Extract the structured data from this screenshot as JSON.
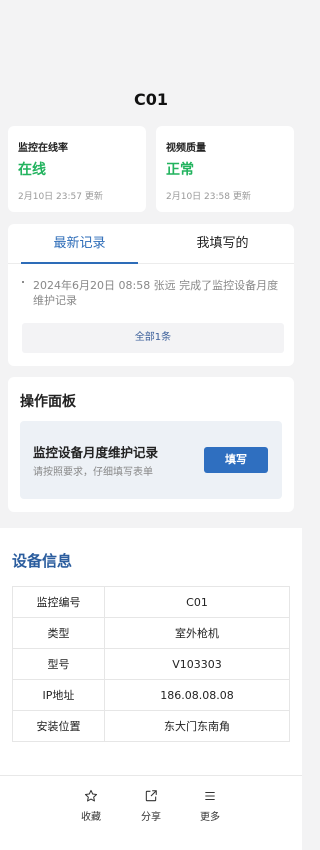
{
  "device": {
    "title": "C01"
  },
  "stats": [
    {
      "label": "监控在线率",
      "value": "在线",
      "time": "2月10日 23:57 更新"
    },
    {
      "label": "视频质量",
      "value": "正常",
      "time": "2月10日 23:58 更新"
    }
  ],
  "records": {
    "tabs": [
      "最新记录",
      "我填写的"
    ],
    "active_tab": "最新记录",
    "items": [
      {
        "text": "2024年6月20日 08:58  张远  完成了监控设备月度维护记录"
      }
    ],
    "all_label": "全部1条"
  },
  "ops": {
    "title": "操作面板",
    "task_name": "监控设备月度维护记录",
    "task_desc": "请按照要求，仔细填写表单",
    "fill_label": "填写"
  },
  "info": {
    "title": "设备信息",
    "rows": [
      {
        "key": "监控编号",
        "value": "C01"
      },
      {
        "key": "类型",
        "value": "室外枪机"
      },
      {
        "key": "型号",
        "value": "V103303"
      },
      {
        "key": "IP地址",
        "value": "186.08.08.08"
      },
      {
        "key": "安装位置",
        "value": "东大门东南角"
      }
    ]
  },
  "bottom": {
    "favorite_label": "收藏",
    "favorite_icon": "star-icon",
    "share_label": "分享",
    "share_icon": "share-icon",
    "more_label": "更多",
    "more_icon": "menu-icon"
  },
  "colors": {
    "accent": "#2f6fc0",
    "status_ok": "#22b35e",
    "section_title": "#2b5d9e"
  }
}
